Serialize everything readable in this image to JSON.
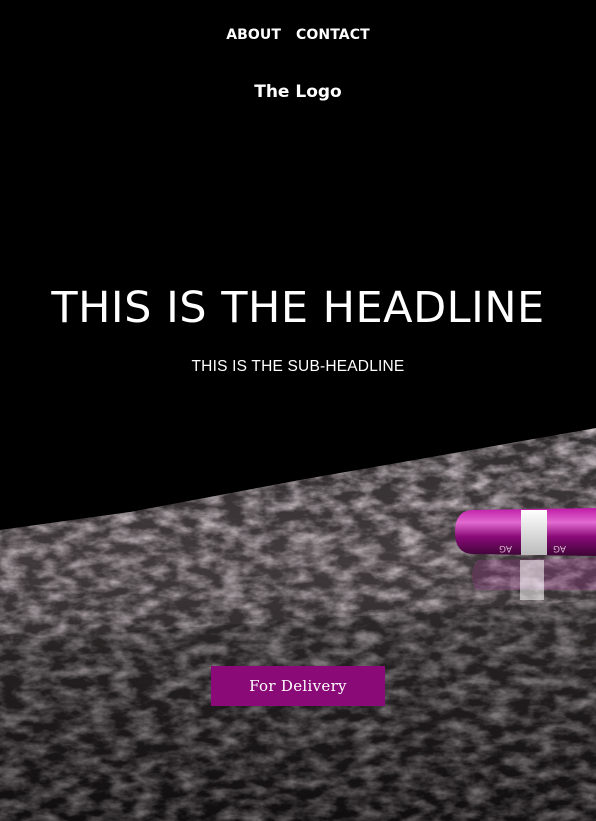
{
  "nav": {
    "items": [
      {
        "label": "ABOUT"
      },
      {
        "label": "CONTACT"
      }
    ]
  },
  "logo": {
    "text": "The Logo"
  },
  "hero": {
    "headline": "THIS IS THE HEADLINE",
    "subheadline": "THIS IS THE SUB-HEADLINE",
    "cta_label": "For Delivery",
    "pill_text": "AG"
  },
  "colors": {
    "background": "#000000",
    "accent": "#8a0a78",
    "text": "#ffffff"
  }
}
